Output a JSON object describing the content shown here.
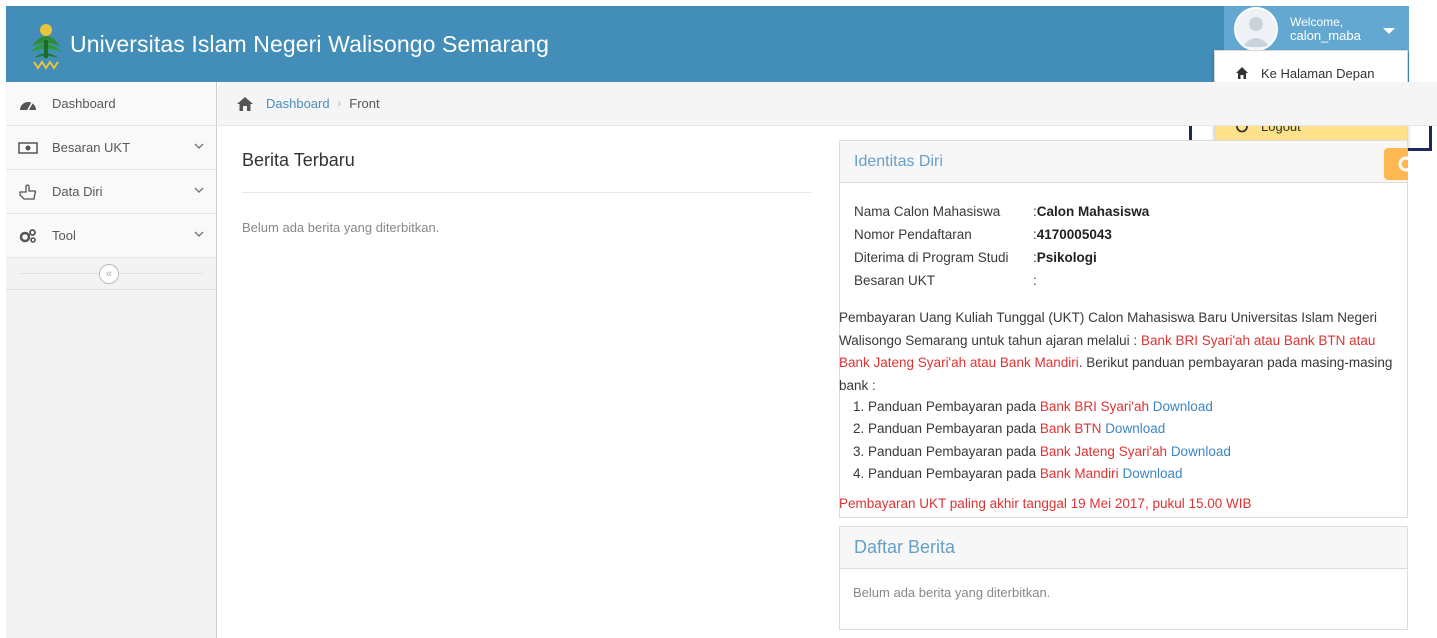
{
  "app": {
    "title": "Universitas Islam Negeri Walisongo Semarang"
  },
  "user": {
    "welcome": "Welcome,",
    "name": "calon_maba"
  },
  "user_menu": {
    "items": [
      {
        "label": "Ke Halaman Depan",
        "icon": "home-icon"
      },
      {
        "label": "Logout",
        "icon": "power-icon"
      }
    ]
  },
  "sidebar": {
    "items": [
      {
        "label": "Dashboard",
        "icon": "tachometer-icon"
      },
      {
        "label": "Besaran UKT",
        "icon": "money-icon"
      },
      {
        "label": "Data Diri",
        "icon": "hand-pointer-icon"
      },
      {
        "label": "Tool",
        "icon": "cogs-icon"
      }
    ],
    "collapse_symbol": "«"
  },
  "breadcrumb": {
    "home": "Dashboard",
    "separator": "›",
    "current": "Front"
  },
  "news": {
    "title": "Berita Terbaru",
    "empty": "Belum ada berita yang diterbitkan."
  },
  "identity": {
    "title": "Identitas Diri",
    "rows": [
      {
        "label": "Nama Calon Mahasiswa",
        "sep": ": ",
        "value": "Calon Mahasiswa"
      },
      {
        "label": "Nomor Pendaftaran",
        "sep": ": ",
        "value": "4170005043"
      },
      {
        "label": "Diterima di Program Studi",
        "sep": ": ",
        "value": "Psikologi"
      },
      {
        "label": "Besaran UKT",
        "sep": ":",
        "value": ""
      }
    ],
    "payment_intro": "Pembayaran Uang Kuliah Tunggal (UKT) Calon Mahasiswa Baru Universitas Islam Negeri Walisongo Semarang untuk tahun ajaran melalui : ",
    "payment_banks": "Bank BRI Syari'ah atau Bank BTN atau Bank Jateng Syari'ah atau Bank Mandiri",
    "payment_outro": ". Berikut panduan pembayaran pada masing-masing bank :",
    "guides": [
      {
        "prefix": "1. Panduan Pembayaran pada ",
        "bank": "Bank BRI Syari'ah",
        "link": "Download"
      },
      {
        "prefix": "2. Panduan Pembayaran pada ",
        "bank": "Bank BTN",
        "link": "Download"
      },
      {
        "prefix": "3. Panduan Pembayaran pada ",
        "bank": "Bank Jateng Syari'ah",
        "link": "Download"
      },
      {
        "prefix": "4. Panduan Pembayaran pada ",
        "bank": "Bank Mandiri",
        "link": "Download"
      }
    ],
    "deadline": "Pembayaran UKT paling akhir tanggal 19 Mei 2017, pukul 15.00 WIB"
  },
  "news_list": {
    "title": "Daftar Berita",
    "empty": "Belum ada berita yang diterbitkan."
  },
  "colors": {
    "navbar": "#438eb9",
    "accent_red": "#dd3333",
    "link_blue": "#3c86c4",
    "highlight": "#fee188",
    "annotation_box": "#1b2a5b"
  }
}
